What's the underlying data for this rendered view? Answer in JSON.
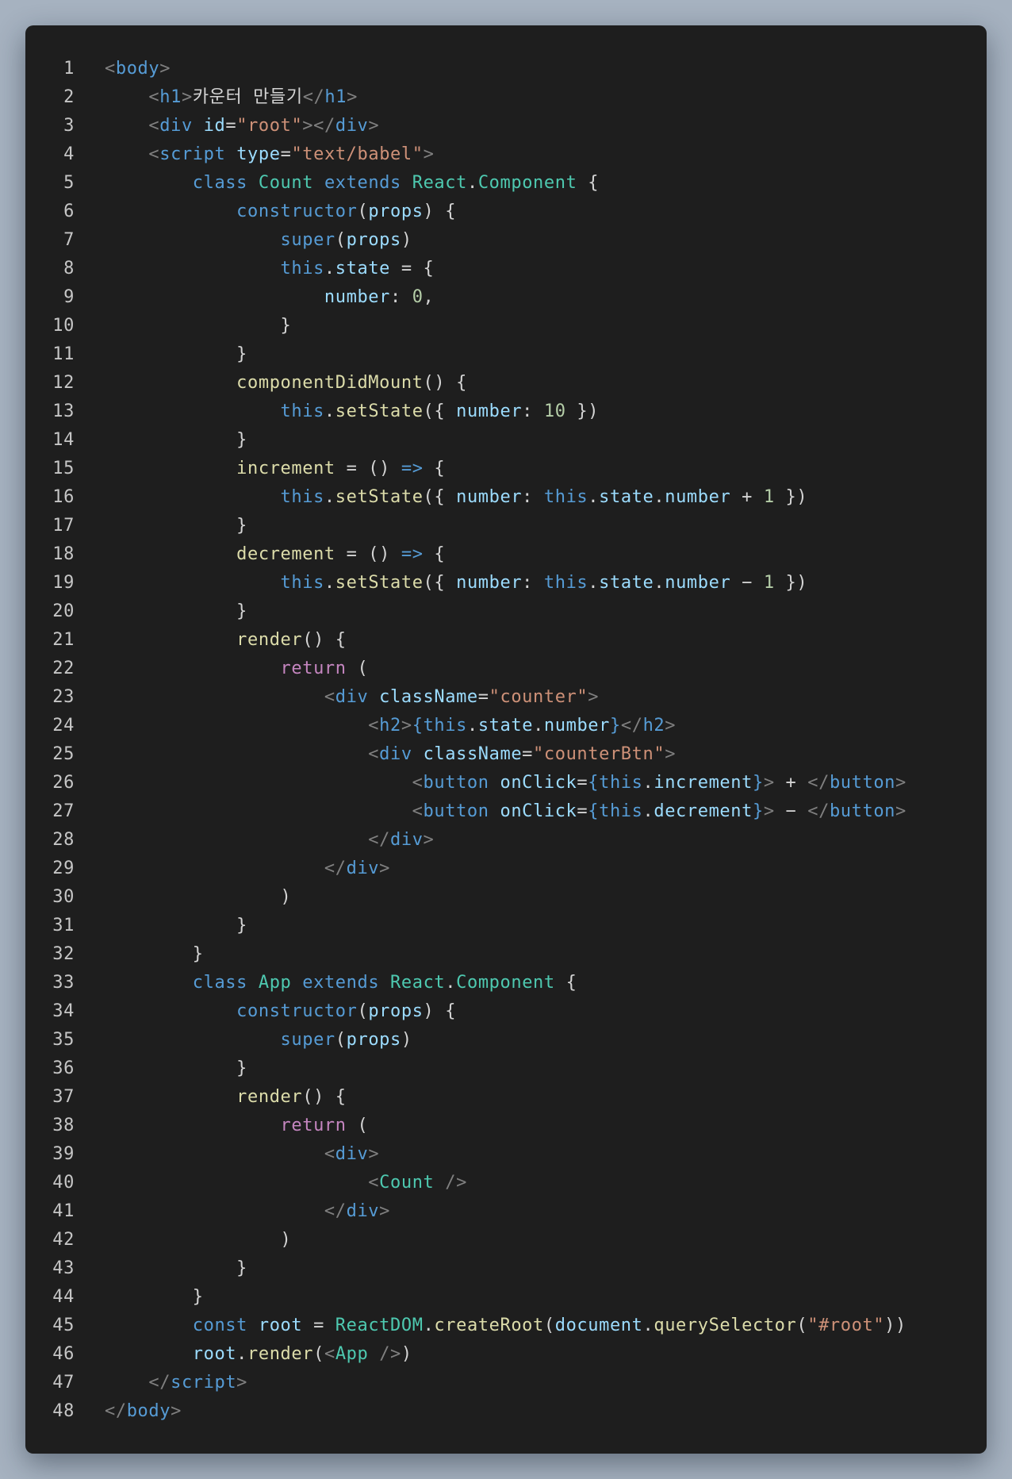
{
  "editor": {
    "colors": {
      "background": "#1e1e1e",
      "page_background": "#a6b2c0",
      "tag": "#569cd6",
      "attribute": "#9cdcfe",
      "string": "#ce9178",
      "keyword": "#569cd6",
      "class": "#4ec9b0",
      "function": "#dcdcaa",
      "number": "#b5cea8",
      "control": "#c586c0",
      "text": "#d4d4d4"
    },
    "lines": [
      {
        "n": "1",
        "indent": 0,
        "tokens": [
          [
            "<",
            "punc"
          ],
          [
            "body",
            "tag"
          ],
          [
            ">",
            "punc"
          ]
        ]
      },
      {
        "n": "2",
        "indent": 1,
        "tokens": [
          [
            "<",
            "punc"
          ],
          [
            "h1",
            "tag"
          ],
          [
            ">",
            "punc"
          ],
          [
            "카운터 만들기",
            "txt"
          ],
          [
            "</",
            "punc"
          ],
          [
            "h1",
            "tag"
          ],
          [
            ">",
            "punc"
          ]
        ]
      },
      {
        "n": "3",
        "indent": 1,
        "tokens": [
          [
            "<",
            "punc"
          ],
          [
            "div",
            "tag"
          ],
          [
            " ",
            "plain"
          ],
          [
            "id",
            "attr"
          ],
          [
            "=",
            "plain"
          ],
          [
            "\"root\"",
            "str"
          ],
          [
            "></",
            "punc"
          ],
          [
            "div",
            "tag"
          ],
          [
            ">",
            "punc"
          ]
        ]
      },
      {
        "n": "4",
        "indent": 1,
        "tokens": [
          [
            "<",
            "punc"
          ],
          [
            "script",
            "tag"
          ],
          [
            " ",
            "plain"
          ],
          [
            "type",
            "attr"
          ],
          [
            "=",
            "plain"
          ],
          [
            "\"text/babel\"",
            "str"
          ],
          [
            ">",
            "punc"
          ]
        ]
      },
      {
        "n": "5",
        "indent": 2,
        "tokens": [
          [
            "class",
            "kw"
          ],
          [
            " ",
            "plain"
          ],
          [
            "Count",
            "cls"
          ],
          [
            " ",
            "plain"
          ],
          [
            "extends",
            "kw"
          ],
          [
            " ",
            "plain"
          ],
          [
            "React",
            "cls"
          ],
          [
            ".",
            "plain"
          ],
          [
            "Component",
            "cls"
          ],
          [
            " {",
            "plain"
          ]
        ]
      },
      {
        "n": "6",
        "indent": 3,
        "tokens": [
          [
            "constructor",
            "kw"
          ],
          [
            "(",
            "plain"
          ],
          [
            "props",
            "var"
          ],
          [
            ") {",
            "plain"
          ]
        ]
      },
      {
        "n": "7",
        "indent": 4,
        "tokens": [
          [
            "super",
            "kw"
          ],
          [
            "(",
            "plain"
          ],
          [
            "props",
            "var"
          ],
          [
            ")",
            "plain"
          ]
        ]
      },
      {
        "n": "8",
        "indent": 4,
        "tokens": [
          [
            "this",
            "kw"
          ],
          [
            ".",
            "plain"
          ],
          [
            "state",
            "var"
          ],
          [
            " = {",
            "plain"
          ]
        ]
      },
      {
        "n": "9",
        "indent": 5,
        "tokens": [
          [
            "number",
            "var"
          ],
          [
            ": ",
            "plain"
          ],
          [
            "0",
            "num"
          ],
          [
            ",",
            "plain"
          ]
        ]
      },
      {
        "n": "10",
        "indent": 4,
        "tokens": [
          [
            "}",
            "plain"
          ]
        ]
      },
      {
        "n": "11",
        "indent": 3,
        "tokens": [
          [
            "}",
            "plain"
          ]
        ]
      },
      {
        "n": "12",
        "indent": 3,
        "tokens": [
          [
            "componentDidMount",
            "fn"
          ],
          [
            "() {",
            "plain"
          ]
        ]
      },
      {
        "n": "13",
        "indent": 4,
        "tokens": [
          [
            "this",
            "kw"
          ],
          [
            ".",
            "plain"
          ],
          [
            "setState",
            "fn"
          ],
          [
            "({ ",
            "plain"
          ],
          [
            "number",
            "var"
          ],
          [
            ": ",
            "plain"
          ],
          [
            "10",
            "num"
          ],
          [
            " })",
            "plain"
          ]
        ]
      },
      {
        "n": "14",
        "indent": 3,
        "tokens": [
          [
            "}",
            "plain"
          ]
        ]
      },
      {
        "n": "15",
        "indent": 3,
        "tokens": [
          [
            "increment",
            "fn"
          ],
          [
            " = () ",
            "plain"
          ],
          [
            "=>",
            "kw"
          ],
          [
            " {",
            "plain"
          ]
        ]
      },
      {
        "n": "16",
        "indent": 4,
        "tokens": [
          [
            "this",
            "kw"
          ],
          [
            ".",
            "plain"
          ],
          [
            "setState",
            "fn"
          ],
          [
            "({ ",
            "plain"
          ],
          [
            "number",
            "var"
          ],
          [
            ": ",
            "plain"
          ],
          [
            "this",
            "kw"
          ],
          [
            ".",
            "plain"
          ],
          [
            "state",
            "var"
          ],
          [
            ".",
            "plain"
          ],
          [
            "number",
            "var"
          ],
          [
            " + ",
            "plain"
          ],
          [
            "1",
            "num"
          ],
          [
            " })",
            "plain"
          ]
        ]
      },
      {
        "n": "17",
        "indent": 3,
        "tokens": [
          [
            "}",
            "plain"
          ]
        ]
      },
      {
        "n": "18",
        "indent": 3,
        "tokens": [
          [
            "decrement",
            "fn"
          ],
          [
            " = () ",
            "plain"
          ],
          [
            "=>",
            "kw"
          ],
          [
            " {",
            "plain"
          ]
        ]
      },
      {
        "n": "19",
        "indent": 4,
        "tokens": [
          [
            "this",
            "kw"
          ],
          [
            ".",
            "plain"
          ],
          [
            "setState",
            "fn"
          ],
          [
            "({ ",
            "plain"
          ],
          [
            "number",
            "var"
          ],
          [
            ": ",
            "plain"
          ],
          [
            "this",
            "kw"
          ],
          [
            ".",
            "plain"
          ],
          [
            "state",
            "var"
          ],
          [
            ".",
            "plain"
          ],
          [
            "number",
            "var"
          ],
          [
            " − ",
            "plain"
          ],
          [
            "1",
            "num"
          ],
          [
            " })",
            "plain"
          ]
        ]
      },
      {
        "n": "20",
        "indent": 3,
        "tokens": [
          [
            "}",
            "plain"
          ]
        ]
      },
      {
        "n": "21",
        "indent": 3,
        "tokens": [
          [
            "render",
            "fn"
          ],
          [
            "() {",
            "plain"
          ]
        ]
      },
      {
        "n": "22",
        "indent": 4,
        "tokens": [
          [
            "return",
            "ctrl"
          ],
          [
            " (",
            "plain"
          ]
        ]
      },
      {
        "n": "23",
        "indent": 5,
        "tokens": [
          [
            "<",
            "punc"
          ],
          [
            "div",
            "tag"
          ],
          [
            " ",
            "plain"
          ],
          [
            "className",
            "attr"
          ],
          [
            "=",
            "plain"
          ],
          [
            "\"counter\"",
            "str"
          ],
          [
            ">",
            "punc"
          ]
        ]
      },
      {
        "n": "24",
        "indent": 6,
        "tokens": [
          [
            "<",
            "punc"
          ],
          [
            "h2",
            "tag"
          ],
          [
            ">",
            "punc"
          ],
          [
            "{",
            "tag"
          ],
          [
            "this",
            "kw"
          ],
          [
            ".",
            "plain"
          ],
          [
            "state",
            "var"
          ],
          [
            ".",
            "plain"
          ],
          [
            "number",
            "var"
          ],
          [
            "}",
            "tag"
          ],
          [
            "</",
            "punc"
          ],
          [
            "h2",
            "tag"
          ],
          [
            ">",
            "punc"
          ]
        ]
      },
      {
        "n": "25",
        "indent": 6,
        "tokens": [
          [
            "<",
            "punc"
          ],
          [
            "div",
            "tag"
          ],
          [
            " ",
            "plain"
          ],
          [
            "className",
            "attr"
          ],
          [
            "=",
            "plain"
          ],
          [
            "\"counterBtn\"",
            "str"
          ],
          [
            ">",
            "punc"
          ]
        ]
      },
      {
        "n": "26",
        "indent": 7,
        "tokens": [
          [
            "<",
            "punc"
          ],
          [
            "button",
            "tag"
          ],
          [
            " ",
            "plain"
          ],
          [
            "onClick",
            "attr"
          ],
          [
            "=",
            "plain"
          ],
          [
            "{",
            "tag"
          ],
          [
            "this",
            "kw"
          ],
          [
            ".",
            "plain"
          ],
          [
            "increment",
            "var"
          ],
          [
            "}",
            "tag"
          ],
          [
            ">",
            "punc"
          ],
          [
            " + ",
            "plain"
          ],
          [
            "</",
            "punc"
          ],
          [
            "button",
            "tag"
          ],
          [
            ">",
            "punc"
          ]
        ]
      },
      {
        "n": "27",
        "indent": 7,
        "tokens": [
          [
            "<",
            "punc"
          ],
          [
            "button",
            "tag"
          ],
          [
            " ",
            "plain"
          ],
          [
            "onClick",
            "attr"
          ],
          [
            "=",
            "plain"
          ],
          [
            "{",
            "tag"
          ],
          [
            "this",
            "kw"
          ],
          [
            ".",
            "plain"
          ],
          [
            "decrement",
            "var"
          ],
          [
            "}",
            "tag"
          ],
          [
            ">",
            "punc"
          ],
          [
            " − ",
            "plain"
          ],
          [
            "</",
            "punc"
          ],
          [
            "button",
            "tag"
          ],
          [
            ">",
            "punc"
          ]
        ]
      },
      {
        "n": "28",
        "indent": 6,
        "tokens": [
          [
            "</",
            "punc"
          ],
          [
            "div",
            "tag"
          ],
          [
            ">",
            "punc"
          ]
        ]
      },
      {
        "n": "29",
        "indent": 5,
        "tokens": [
          [
            "</",
            "punc"
          ],
          [
            "div",
            "tag"
          ],
          [
            ">",
            "punc"
          ]
        ]
      },
      {
        "n": "30",
        "indent": 4,
        "tokens": [
          [
            ")",
            "plain"
          ]
        ]
      },
      {
        "n": "31",
        "indent": 3,
        "tokens": [
          [
            "}",
            "plain"
          ]
        ]
      },
      {
        "n": "32",
        "indent": 2,
        "tokens": [
          [
            "}",
            "plain"
          ]
        ]
      },
      {
        "n": "33",
        "indent": 2,
        "tokens": [
          [
            "class",
            "kw"
          ],
          [
            " ",
            "plain"
          ],
          [
            "App",
            "cls"
          ],
          [
            " ",
            "plain"
          ],
          [
            "extends",
            "kw"
          ],
          [
            " ",
            "plain"
          ],
          [
            "React",
            "cls"
          ],
          [
            ".",
            "plain"
          ],
          [
            "Component",
            "cls"
          ],
          [
            " {",
            "plain"
          ]
        ]
      },
      {
        "n": "34",
        "indent": 3,
        "tokens": [
          [
            "constructor",
            "kw"
          ],
          [
            "(",
            "plain"
          ],
          [
            "props",
            "var"
          ],
          [
            ") {",
            "plain"
          ]
        ]
      },
      {
        "n": "35",
        "indent": 4,
        "tokens": [
          [
            "super",
            "kw"
          ],
          [
            "(",
            "plain"
          ],
          [
            "props",
            "var"
          ],
          [
            ")",
            "plain"
          ]
        ]
      },
      {
        "n": "36",
        "indent": 3,
        "tokens": [
          [
            "}",
            "plain"
          ]
        ]
      },
      {
        "n": "37",
        "indent": 3,
        "tokens": [
          [
            "render",
            "fn"
          ],
          [
            "() {",
            "plain"
          ]
        ]
      },
      {
        "n": "38",
        "indent": 4,
        "tokens": [
          [
            "return",
            "ctrl"
          ],
          [
            " (",
            "plain"
          ]
        ]
      },
      {
        "n": "39",
        "indent": 5,
        "tokens": [
          [
            "<",
            "punc"
          ],
          [
            "div",
            "tag"
          ],
          [
            ">",
            "punc"
          ]
        ]
      },
      {
        "n": "40",
        "indent": 6,
        "tokens": [
          [
            "<",
            "punc"
          ],
          [
            "Count",
            "cls"
          ],
          [
            " />",
            "punc"
          ]
        ]
      },
      {
        "n": "41",
        "indent": 5,
        "tokens": [
          [
            "</",
            "punc"
          ],
          [
            "div",
            "tag"
          ],
          [
            ">",
            "punc"
          ]
        ]
      },
      {
        "n": "42",
        "indent": 4,
        "tokens": [
          [
            ")",
            "plain"
          ]
        ]
      },
      {
        "n": "43",
        "indent": 3,
        "tokens": [
          [
            "}",
            "plain"
          ]
        ]
      },
      {
        "n": "44",
        "indent": 2,
        "tokens": [
          [
            "}",
            "plain"
          ]
        ]
      },
      {
        "n": "45",
        "indent": 2,
        "tokens": [
          [
            "const",
            "kw"
          ],
          [
            " ",
            "plain"
          ],
          [
            "root",
            "var"
          ],
          [
            " = ",
            "plain"
          ],
          [
            "ReactDOM",
            "cls"
          ],
          [
            ".",
            "plain"
          ],
          [
            "createRoot",
            "fn"
          ],
          [
            "(",
            "plain"
          ],
          [
            "document",
            "var"
          ],
          [
            ".",
            "plain"
          ],
          [
            "querySelector",
            "fn"
          ],
          [
            "(",
            "plain"
          ],
          [
            "\"#root\"",
            "str"
          ],
          [
            "))",
            "plain"
          ]
        ]
      },
      {
        "n": "46",
        "indent": 2,
        "tokens": [
          [
            "root",
            "var"
          ],
          [
            ".",
            "plain"
          ],
          [
            "render",
            "fn"
          ],
          [
            "(",
            "plain"
          ],
          [
            "<",
            "punc"
          ],
          [
            "App",
            "cls"
          ],
          [
            " />",
            "punc"
          ],
          [
            ")",
            "plain"
          ]
        ]
      },
      {
        "n": "47",
        "indent": 1,
        "tokens": [
          [
            "</",
            "punc"
          ],
          [
            "script",
            "tag"
          ],
          [
            ">",
            "punc"
          ]
        ]
      },
      {
        "n": "48",
        "indent": 0,
        "tokens": [
          [
            "</",
            "punc"
          ],
          [
            "body",
            "tag"
          ],
          [
            ">",
            "punc"
          ]
        ]
      }
    ]
  }
}
